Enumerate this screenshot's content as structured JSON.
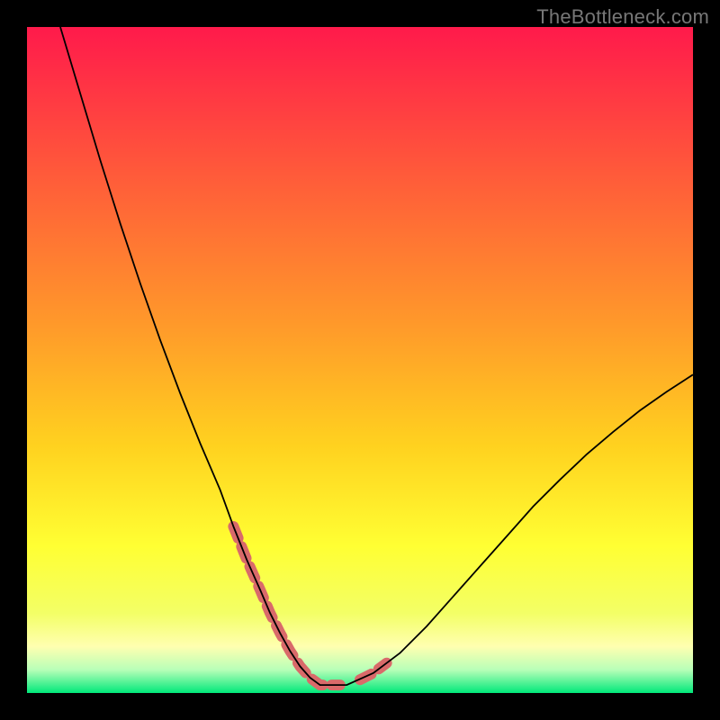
{
  "watermark": "TheBottleneck.com",
  "chart_data": {
    "type": "line",
    "title": "",
    "xlabel": "",
    "ylabel": "",
    "xlim": [
      0,
      100
    ],
    "ylim": [
      0,
      100
    ],
    "grid": false,
    "legend": false,
    "background_gradient": {
      "stops": [
        {
          "offset": 0.0,
          "color": "#ff1a4b"
        },
        {
          "offset": 0.22,
          "color": "#ff5a3a"
        },
        {
          "offset": 0.45,
          "color": "#ff9a2a"
        },
        {
          "offset": 0.63,
          "color": "#ffd21f"
        },
        {
          "offset": 0.78,
          "color": "#ffff33"
        },
        {
          "offset": 0.88,
          "color": "#f3ff66"
        },
        {
          "offset": 0.93,
          "color": "#ffffb0"
        },
        {
          "offset": 0.965,
          "color": "#b8ffb8"
        },
        {
          "offset": 1.0,
          "color": "#00e87a"
        }
      ]
    },
    "series": [
      {
        "name": "bottleneck-curve",
        "color": "#000000",
        "width": 1.8,
        "x": [
          5,
          8,
          11,
          14,
          17,
          20,
          23,
          26,
          29,
          31,
          33,
          35,
          36.5,
          38,
          39.5,
          41,
          42.5,
          44,
          48,
          52,
          56,
          60,
          64,
          68,
          72,
          76,
          80,
          84,
          88,
          92,
          96,
          100
        ],
        "y": [
          100,
          90,
          80,
          70.5,
          61.5,
          53,
          45,
          37.5,
          30.5,
          25,
          20,
          15.5,
          12,
          9,
          6.3,
          4,
          2.3,
          1.2,
          1.2,
          3,
          6,
          10,
          14.5,
          19,
          23.5,
          28,
          32,
          35.8,
          39.2,
          42.4,
          45.2,
          47.8
        ]
      }
    ],
    "marker_band": {
      "name": "optimal-zone",
      "color": "#d96a6a",
      "width": 12,
      "segments": [
        {
          "x": [
            31,
            33,
            35,
            36.5,
            38,
            39.5,
            41,
            42.5,
            44,
            47
          ],
          "y": [
            25,
            20,
            15.5,
            12,
            9,
            6.3,
            4,
            2.3,
            1.2,
            1.2
          ]
        },
        {
          "x": [
            50,
            52,
            54
          ],
          "y": [
            2,
            3,
            4.5
          ]
        }
      ]
    }
  }
}
